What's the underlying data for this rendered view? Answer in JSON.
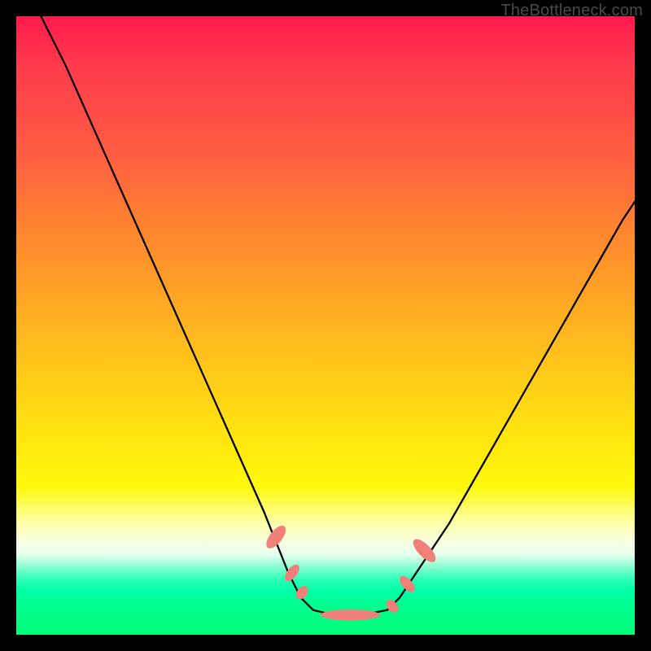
{
  "watermark": "TheBottleneck.com",
  "chart_data": {
    "type": "line",
    "title": "",
    "xlabel": "",
    "ylabel": "",
    "xlim": [
      0,
      100
    ],
    "ylim": [
      0,
      100
    ],
    "series": [
      {
        "name": "left-curve",
        "x": [
          4,
          8,
          12,
          16,
          20,
          24,
          28,
          32,
          36,
          40,
          42,
          44,
          46,
          48
        ],
        "y": [
          100,
          92,
          83,
          74,
          65,
          56,
          47,
          38,
          29,
          20,
          15,
          10,
          6,
          4
        ]
      },
      {
        "name": "valley",
        "x": [
          48,
          50,
          52,
          54,
          56,
          58,
          60
        ],
        "y": [
          4,
          3.5,
          3.3,
          3.2,
          3.3,
          3.6,
          4
        ]
      },
      {
        "name": "right-curve",
        "x": [
          60,
          62,
          66,
          70,
          74,
          78,
          82,
          86,
          90,
          94,
          98,
          100
        ],
        "y": [
          4,
          6,
          12,
          18,
          25,
          32,
          39,
          46,
          53,
          60,
          67,
          70
        ]
      }
    ],
    "markers": [
      {
        "name": "left-bead-1",
        "cx": 42.0,
        "cy": 15.8,
        "rx": 1.0,
        "ry": 2.2,
        "rot": 38
      },
      {
        "name": "left-bead-2",
        "cx": 44.6,
        "cy": 10.0,
        "rx": 0.8,
        "ry": 1.6,
        "rot": 38
      },
      {
        "name": "left-bead-3",
        "cx": 46.2,
        "cy": 6.8,
        "rx": 0.8,
        "ry": 1.2,
        "rot": 38
      },
      {
        "name": "flat-bead",
        "cx": 54.0,
        "cy": 3.2,
        "rx": 4.8,
        "ry": 0.9,
        "rot": 0
      },
      {
        "name": "right-bead-1",
        "cx": 60.8,
        "cy": 4.6,
        "rx": 0.8,
        "ry": 1.2,
        "rot": -40
      },
      {
        "name": "right-bead-2",
        "cx": 63.2,
        "cy": 8.2,
        "rx": 0.8,
        "ry": 1.6,
        "rot": -42
      },
      {
        "name": "right-bead-3",
        "cx": 66.0,
        "cy": 13.6,
        "rx": 1.0,
        "ry": 2.4,
        "rot": -44
      }
    ],
    "marker_color": "#f08077",
    "line_color": "#000000"
  }
}
